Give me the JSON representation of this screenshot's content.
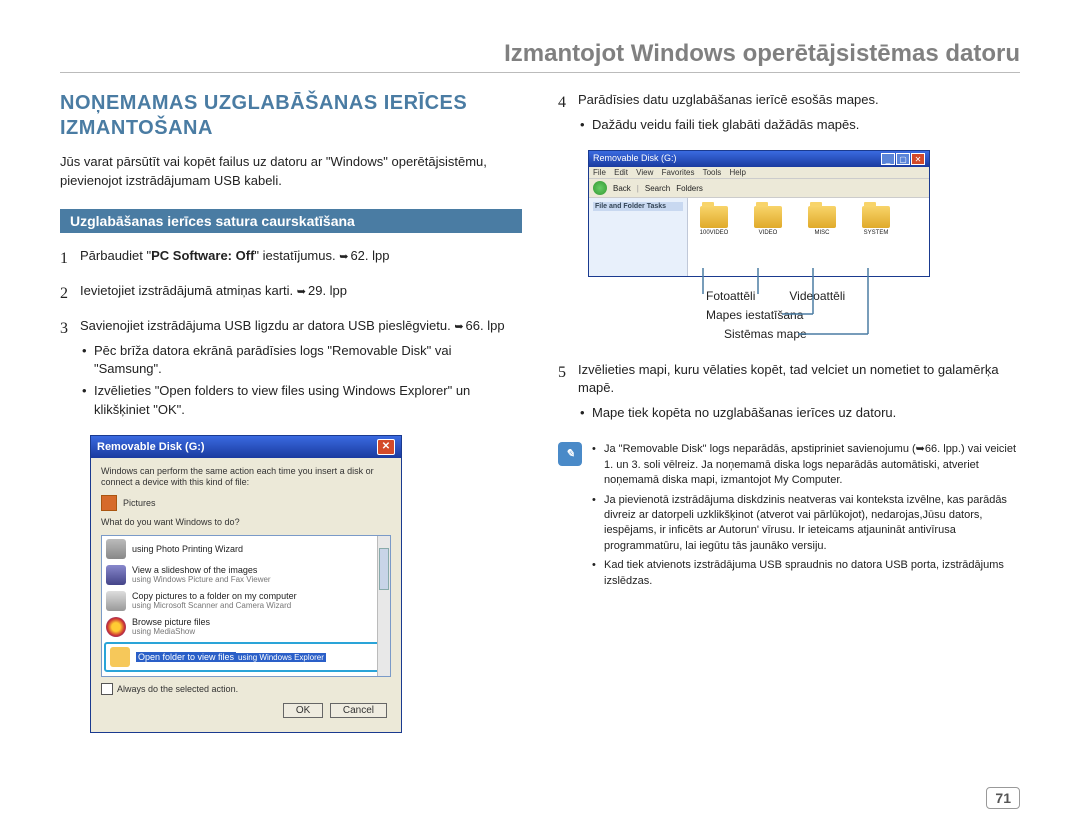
{
  "header": "Izmantojot Windows operētājsistēmas datoru",
  "section_title": "NOŅEMAMAS UZGLABĀŠANAS IERĪCES IZMANTOŠANA",
  "intro": "Jūs varat pārsūtīt vai kopēt failus uz datoru ar \"Windows\" operētājsistēmu, pievienojot izstrādājumam USB kabeli.",
  "subhead": "Uzglabāšanas ierīces satura caurskatīšana",
  "steps": [
    {
      "num": "1",
      "text_pre": "Pārbaudiet \"",
      "bold": "PC Software: Off",
      "text_post": "\" iestatījumus. ",
      "ref": "62. lpp"
    },
    {
      "num": "2",
      "text": "Ievietojiet izstrādājumā atmiņas karti. ",
      "ref": "29. lpp"
    },
    {
      "num": "3",
      "text": "Savienojiet izstrādājuma USB ligzdu ar datora USB pieslēgvietu. ",
      "ref": "66. lpp",
      "bullets": [
        "Pēc brīža datora ekrānā parādīsies logs \"Removable Disk\" vai \"Samsung\".",
        "Izvēlieties \"Open folders to view files using Windows Explorer\" un klikšķiniet \"OK\"."
      ]
    },
    {
      "num": "4",
      "text": "Parādīsies datu uzglabāšanas ierīcē esošās mapes.",
      "bullets": [
        "Dažādu veidu faili tiek glabāti dažādās mapēs."
      ]
    },
    {
      "num": "5",
      "text": "Izvēlieties mapi, kuru vēlaties kopēt, tad velciet un nometiet to galamērķa mapē.",
      "bullets": [
        "Mape tiek kopēta no uzglabāšanas ierīces uz datoru."
      ]
    }
  ],
  "dialog": {
    "title": "Removable Disk (G:)",
    "intro": "Windows can perform the same action each time you insert a disk or connect a device with this kind of file:",
    "pictures": "Pictures",
    "what": "What do you want Windows to do?",
    "opts": [
      {
        "t1": "using Photo Printing Wizard",
        "t2": ""
      },
      {
        "t1": "View a slideshow of the images",
        "t2": "using Windows Picture and Fax Viewer"
      },
      {
        "t1": "Copy pictures to a folder on my computer",
        "t2": "using Microsoft Scanner and Camera Wizard"
      },
      {
        "t1": "Browse picture files",
        "t2": "using MediaShow"
      },
      {
        "t1": "Open folder to view files",
        "t2": "using Windows Explorer"
      }
    ],
    "always": "Always do the selected action.",
    "ok": "OK",
    "cancel": "Cancel"
  },
  "explorer": {
    "title": "Removable Disk (G:)",
    "menu": [
      "File",
      "Edit",
      "View",
      "Favorites",
      "Tools",
      "Help"
    ],
    "toolbar": [
      "Back",
      "",
      "Search",
      "Folders"
    ],
    "side_title": "File and Folder Tasks",
    "folders": [
      "100VIDEO",
      "VIDEO",
      "MISC",
      "SYSTEM"
    ]
  },
  "callouts": {
    "foto": "Fotoattēli",
    "video": "Videoattēli",
    "mapes": "Mapes iestatīšana",
    "sist": "Sistēmas mape"
  },
  "note": [
    "Ja \"Removable Disk\" logs neparādās, apstipriniet savienojumu (➥66. lpp.) vai veiciet 1. un 3. soli vēlreiz. Ja noņemamā diska logs neparādās automātiski, atveriet noņemamā diska mapi, izmantojot My Computer.",
    "Ja pievienotā izstrādājuma diskdzinis neatveras vai konteksta izvēlne, kas parādās divreiz ar datorpeli uzklikšķinot (atverot vai pārlūkojot), nedarojas,Jūsu dators, iespējams, ir inficēts ar Autorun' vīrusu. Ir ieteicams atjaunināt antivīrusa programmatūru, lai iegūtu tās jaunāko versiju.",
    "Kad tiek atvienots izstrādājuma USB spraudnis no datora USB porta, izstrādājums izslēdzas."
  ],
  "page_number": "71"
}
